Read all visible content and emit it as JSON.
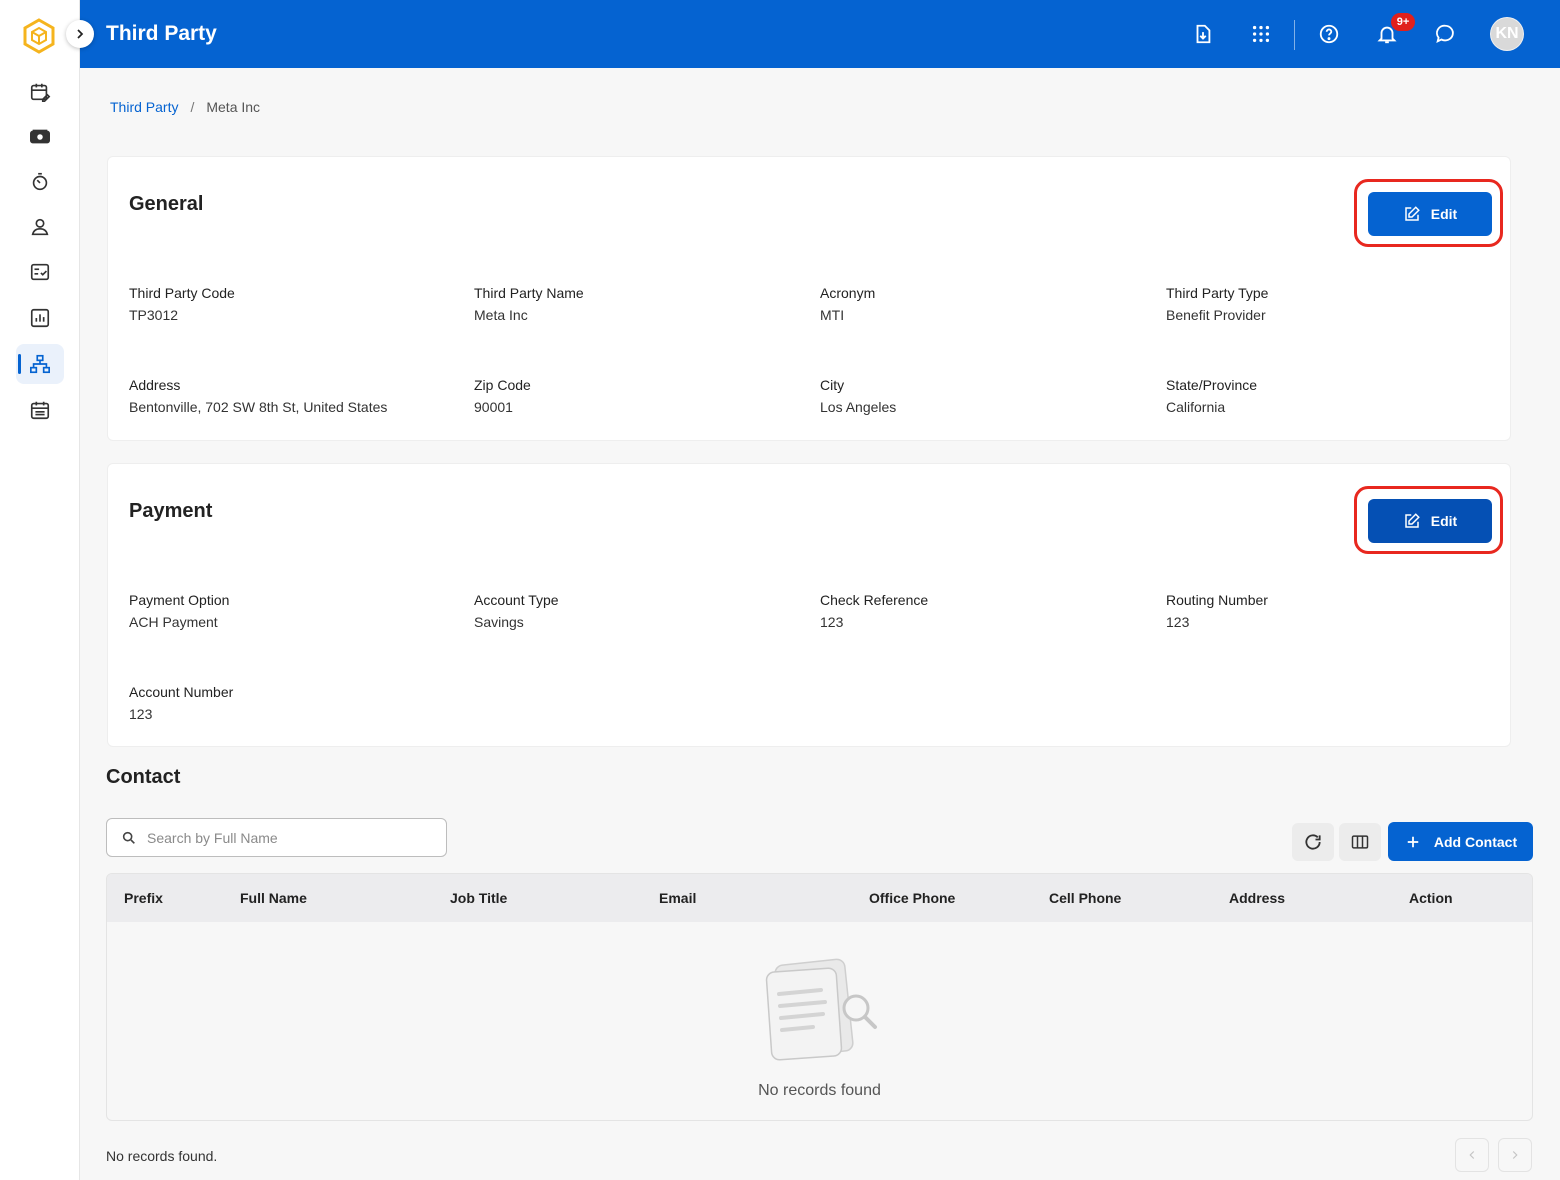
{
  "app": {
    "title": "Third Party"
  },
  "header": {
    "notification_badge": "9+",
    "avatar_initials": "KN"
  },
  "breadcrumb": {
    "parent": "Third Party",
    "separator": "/",
    "current": "Meta Inc"
  },
  "general": {
    "title": "General",
    "edit_label": "Edit",
    "fields": [
      {
        "label": "Third Party Code",
        "value": "TP3012"
      },
      {
        "label": "Third Party Name",
        "value": "Meta Inc"
      },
      {
        "label": "Acronym",
        "value": "MTI"
      },
      {
        "label": "Third Party Type",
        "value": "Benefit Provider"
      },
      {
        "label": "Address",
        "value": "Bentonville, 702 SW 8th St, United States"
      },
      {
        "label": "Zip Code",
        "value": "90001"
      },
      {
        "label": "City",
        "value": "Los Angeles"
      },
      {
        "label": "State/Province",
        "value": "California"
      }
    ]
  },
  "payment": {
    "title": "Payment",
    "edit_label": "Edit",
    "fields": [
      {
        "label": "Payment Option",
        "value": "ACH Payment"
      },
      {
        "label": "Account Type",
        "value": "Savings"
      },
      {
        "label": "Check Reference",
        "value": "123"
      },
      {
        "label": "Routing Number",
        "value": "123"
      },
      {
        "label": "Account Number",
        "value": "123"
      }
    ]
  },
  "contact": {
    "title": "Contact",
    "search_placeholder": "Search by Full Name",
    "add_label": "Add Contact",
    "columns": [
      "Prefix",
      "Full Name",
      "Job Title",
      "Email",
      "Office Phone",
      "Cell Phone",
      "Address",
      "Action"
    ],
    "empty_text": "No records found",
    "footer_text": "No records found."
  },
  "colors": {
    "primary": "#0563d1",
    "highlight": "#e8281f",
    "badge": "#e0201c"
  }
}
